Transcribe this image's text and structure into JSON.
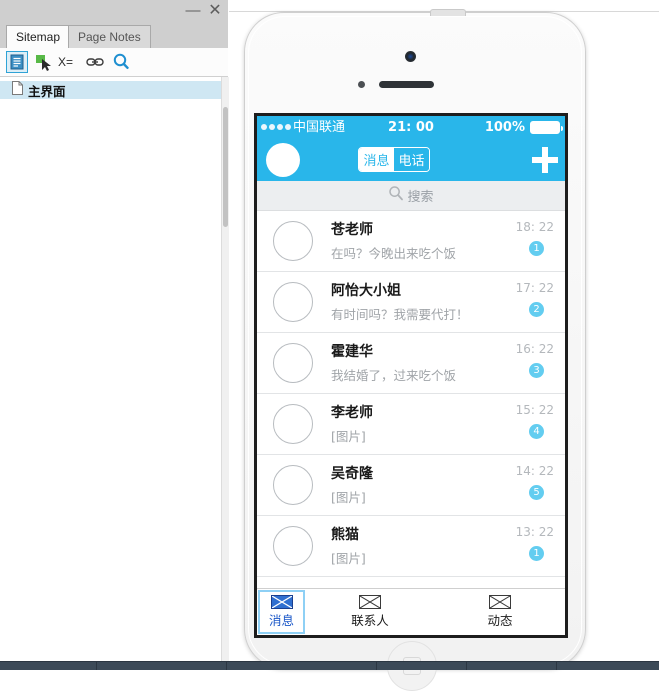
{
  "left_panel": {
    "window_controls": {
      "minimize": "—",
      "close": "✕"
    },
    "tabs": [
      {
        "label": "Sitemap",
        "active": true
      },
      {
        "label": "Page Notes",
        "active": false
      }
    ],
    "toolbar": [
      {
        "name": "add-page-icon",
        "selected": true
      },
      {
        "name": "cursor-icon",
        "selected": false
      },
      {
        "name": "variables-icon",
        "label": "X=",
        "selected": false
      },
      {
        "name": "link-icon",
        "selected": false
      },
      {
        "name": "search-icon",
        "selected": false
      }
    ],
    "tree": [
      {
        "label": "主界面",
        "selected": true
      }
    ]
  },
  "phone": {
    "status_bar": {
      "signal_dots": 4,
      "carrier": "中国联通",
      "time": "21: 00",
      "battery_percent": "100%"
    },
    "nav": {
      "segments": [
        {
          "label": "消息",
          "selected": false
        },
        {
          "label": "电话",
          "selected": true
        }
      ],
      "add_label": "+"
    },
    "search": {
      "placeholder": "搜索"
    },
    "chats": [
      {
        "name": "苍老师",
        "message": "在吗？今晚出来吃个饭",
        "time": "18: 22",
        "badge": "1"
      },
      {
        "name": "阿怡大小姐",
        "message": "有时间吗？我需要代打！",
        "time": "17: 22",
        "badge": "2"
      },
      {
        "name": "霍建华",
        "message": "我结婚了，过来吃个饭",
        "time": "16: 22",
        "badge": "3"
      },
      {
        "name": "李老师",
        "message": "[图片]",
        "time": "15: 22",
        "badge": "4"
      },
      {
        "name": "吴奇隆",
        "message": "[图片]",
        "time": "14: 22",
        "badge": "5"
      },
      {
        "name": "熊猫",
        "message": "[图片]",
        "time": "13: 22",
        "badge": "1"
      }
    ],
    "tabbar": [
      {
        "label": "消息",
        "icon": "broken-image-icon",
        "selected": true
      },
      {
        "label": "联系人",
        "icon": "broken-image-icon",
        "selected": false
      },
      {
        "label": "动态",
        "icon": "broken-image-icon",
        "selected": false
      }
    ]
  },
  "colors": {
    "accent": "#29b6ea",
    "badge": "#63cdf0",
    "tree_selection": "#cfe7f3",
    "tab_selected_text": "#1a57c8",
    "tab_selection_border": "#8ed0f5"
  }
}
